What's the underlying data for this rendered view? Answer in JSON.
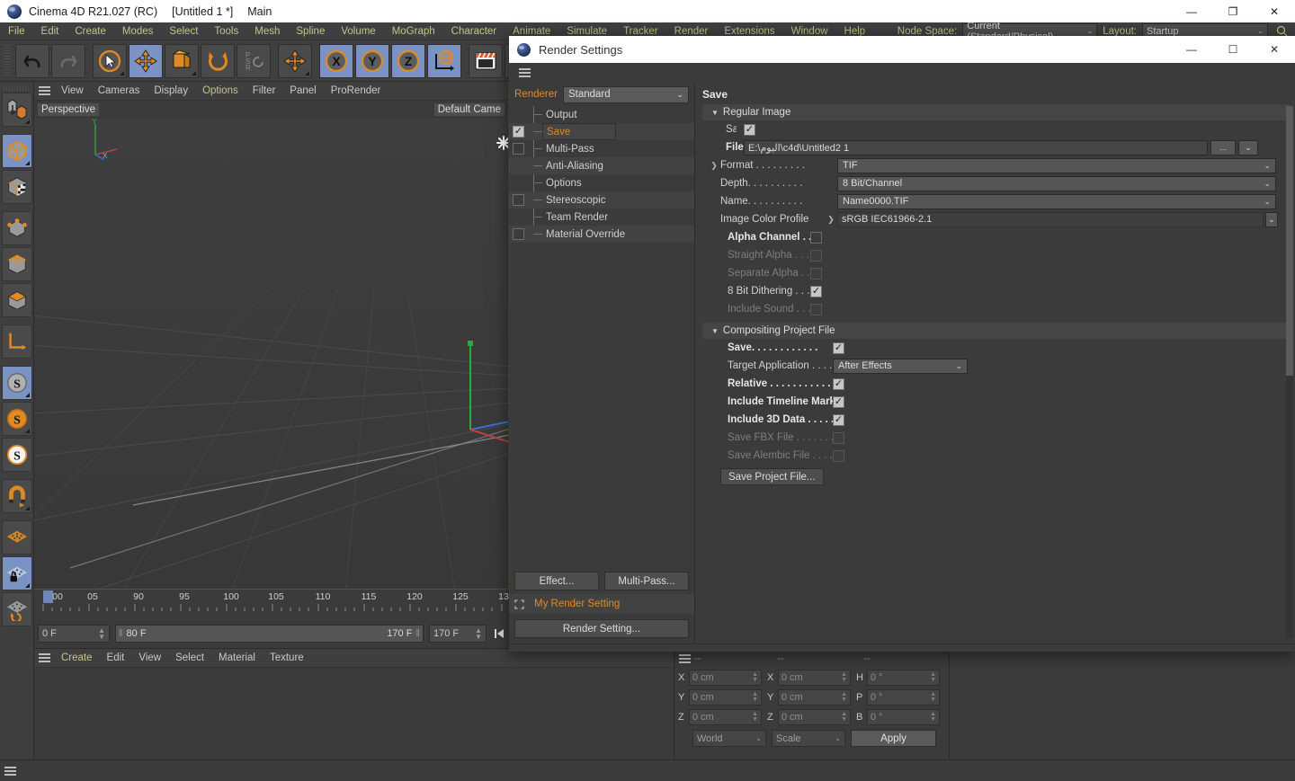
{
  "window": {
    "title_app": "Cinema 4D R21.027 (RC)",
    "title_doc": "[Untitled 1 *]",
    "title_layout": "Main",
    "minimize": "—",
    "maximize": "❐",
    "close": "✕"
  },
  "menubar": {
    "items": [
      "File",
      "Edit",
      "Create",
      "Modes",
      "Select",
      "Tools",
      "Mesh",
      "Spline",
      "Volume",
      "MoGraph",
      "Character",
      "Animate",
      "Simulate",
      "Tracker",
      "Render",
      "Extensions",
      "Window",
      "Help"
    ],
    "node_space_label": "Node Space:",
    "node_space_value": "Current (Standard/Physical)",
    "layout_label": "Layout:",
    "layout_value": "Startup",
    "chevron": "⌄"
  },
  "viewport": {
    "menu": [
      "View",
      "Cameras",
      "Display",
      "Options",
      "Filter",
      "Panel",
      "ProRender"
    ],
    "highlight_menu": "Options",
    "label_left": "Perspective",
    "label_right": "Default Came"
  },
  "timeline": {
    "ticks": [
      "00",
      "05",
      "90",
      "95",
      "100",
      "105",
      "110",
      "115",
      "120",
      "125",
      "13"
    ],
    "current_frame": "0 F",
    "range_start": "80 F",
    "range_end": "170 F",
    "doc_end": "170 F",
    "grip": "‖"
  },
  "material_panel": {
    "menu": [
      "Create",
      "Edit",
      "View",
      "Select",
      "Material",
      "Texture"
    ]
  },
  "coordinates": {
    "headers": [
      "--",
      "--",
      "--"
    ],
    "rows": [
      {
        "a1": "X",
        "v1": "0 cm",
        "a2": "X",
        "v2": "0 cm",
        "a3": "H",
        "v3": "0 °"
      },
      {
        "a1": "Y",
        "v1": "0 cm",
        "a2": "Y",
        "v2": "0 cm",
        "a3": "P",
        "v3": "0 °"
      },
      {
        "a1": "Z",
        "v1": "0 cm",
        "a2": "Z",
        "v2": "0 cm",
        "a3": "B",
        "v3": "0 °"
      }
    ],
    "space_value": "World",
    "mode_value": "Scale",
    "apply_label": "Apply",
    "chevron": "⌄"
  },
  "dialog": {
    "title": "Render Settings",
    "minimize": "—",
    "maximize": "☐",
    "close": "✕",
    "renderer_label": "Renderer",
    "renderer_value": "Standard",
    "chevron": "⌄",
    "tree": [
      {
        "label": "Output",
        "checkbox": "none",
        "selected": false
      },
      {
        "label": "Save",
        "checkbox": "on",
        "selected": true
      },
      {
        "label": "Multi-Pass",
        "checkbox": "off",
        "selected": false
      },
      {
        "label": "Anti-Aliasing",
        "checkbox": "none",
        "selected": false
      },
      {
        "label": "Options",
        "checkbox": "none",
        "selected": false
      },
      {
        "label": "Stereoscopic",
        "checkbox": "off",
        "selected": false
      },
      {
        "label": "Team Render",
        "checkbox": "none",
        "selected": false
      },
      {
        "label": "Material Override",
        "checkbox": "off",
        "selected": false
      }
    ],
    "effect_button": "Effect...",
    "multipass_button": "Multi-Pass...",
    "render_setting_name": "My Render Setting",
    "render_setting_button": "Render Setting...",
    "right": {
      "page_title": "Save",
      "group_regular": "Regular Image",
      "save_label": "Save",
      "save_checked": true,
      "file_label": "File...",
      "file_value": "E:\\اليوم\\c4d\\Untitled2 1",
      "file_browse": "…",
      "format_label": "Format . . . . . . . . .",
      "format_value": "TIF",
      "depth_label": "Depth. . . . . . . . . .",
      "depth_value": "8 Bit/Channel",
      "name_label": "Name. . . . . . . . . .",
      "name_value": "Name0000.TIF",
      "profile_label": "Image Color Profile",
      "profile_value": "sRGB IEC61966-2.1",
      "alpha_label": "Alpha Channel  . . .",
      "alpha_checked": false,
      "straight_label": "Straight Alpha . . . .",
      "straight_checked": false,
      "separate_label": "Separate Alpha  . . .",
      "separate_checked": false,
      "dither_label": "8 Bit Dithering . . . .",
      "dither_checked": true,
      "sound_label": "Include Sound . . . .",
      "sound_checked": false,
      "group_compositing": "Compositing Project File",
      "csave_label": "Save. . . . . . . . . . . .",
      "csave_checked": true,
      "target_label": "Target Application  . . . . .",
      "target_value": "After Effects",
      "relative_label": "Relative . . . . . . . . . . .",
      "relative_checked": true,
      "marker_label": "Include Timeline Marker",
      "marker_checked": true,
      "data3d_label": "Include 3D Data . . . . . .",
      "data3d_checked": true,
      "fbx_label": "Save FBX File . . . . . . . .",
      "fbx_checked": false,
      "alembic_label": "Save Alembic File . . . . . .",
      "alembic_checked": false,
      "save_project_button": "Save Project File..."
    }
  }
}
